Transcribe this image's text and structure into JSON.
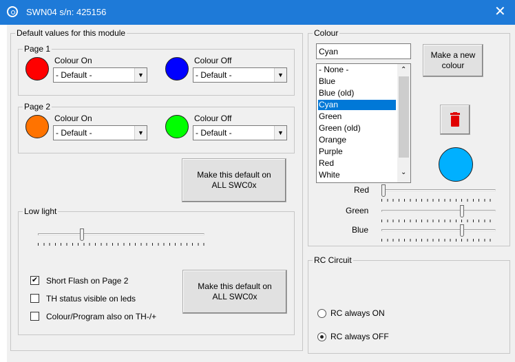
{
  "window": {
    "title": "SWN04 s/n: 425156",
    "close_glyph": "✕"
  },
  "defaults": {
    "group_label": "Default values for this module",
    "page1": {
      "label": "Page 1",
      "colour_on_label": "Colour On",
      "colour_off_label": "Colour Off",
      "on_value": "- Default -",
      "off_value": "- Default -",
      "on_color": "#ff0000",
      "off_color": "#0000ff"
    },
    "page2": {
      "label": "Page 2",
      "colour_on_label": "Colour On",
      "colour_off_label": "Colour Off",
      "on_value": "- Default -",
      "off_value": "- Default -",
      "on_color": "#ff7300",
      "off_color": "#00ff00"
    },
    "make_default_label": "Make this default on ALL SWC0x"
  },
  "low_light": {
    "group_label": "Low light",
    "level": 0.26,
    "short_flash": {
      "label": "Short Flash on Page 2",
      "checked": true
    },
    "th_status": {
      "label": "TH status visible on leds",
      "checked": false
    },
    "colour_program": {
      "label": "Colour/Program also on TH-/+",
      "checked": false
    },
    "make_default_label": "Make this default on ALL SWC0x"
  },
  "colour": {
    "group_label": "Colour",
    "name_value": "Cyan",
    "make_new_label": "Make a new colour",
    "list": [
      "- None -",
      "Blue",
      "Blue (old)",
      "Cyan",
      "Green",
      "Green (old)",
      "Orange",
      "Purple",
      "Red",
      "White"
    ],
    "selected_index": 3,
    "preview_color": "#00b0ff",
    "delete_color": "#e00000",
    "red": {
      "label": "Red",
      "level": 0.0
    },
    "green": {
      "label": "Green",
      "level": 0.71
    },
    "blue": {
      "label": "Blue",
      "level": 0.71
    }
  },
  "rc": {
    "group_label": "RC Circuit",
    "always_on": {
      "label": "RC always ON",
      "selected": false
    },
    "always_off": {
      "label": "RC always OFF",
      "selected": true
    }
  }
}
